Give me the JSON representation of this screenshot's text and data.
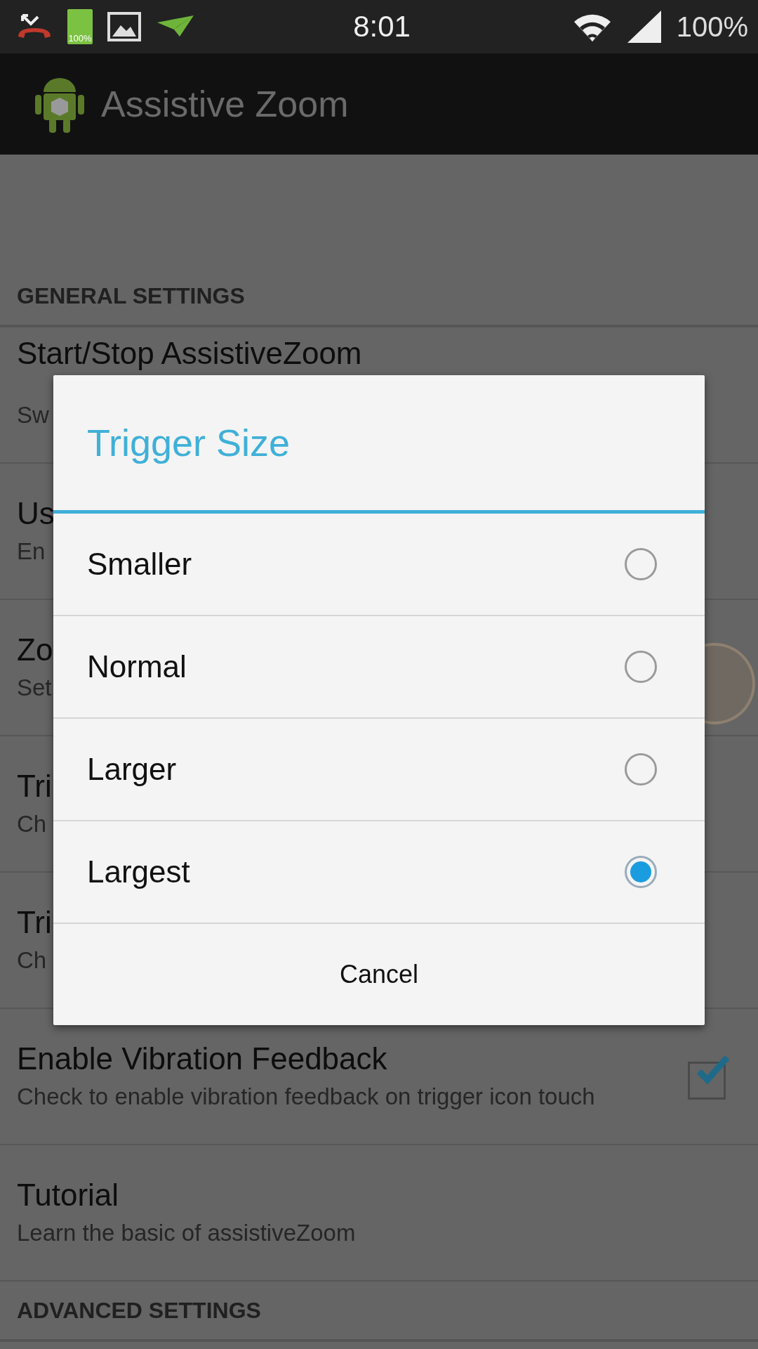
{
  "status_bar": {
    "battery_label": "100%",
    "time": "8:01",
    "battery_percent": "100%"
  },
  "action_bar": {
    "title": "Assistive Zoom"
  },
  "sections": [
    {
      "header": "GENERAL SETTINGS",
      "items": [
        {
          "title": "Start/Stop AssistiveZoom",
          "subtitle": "Sw"
        },
        {
          "title": "Us",
          "subtitle": "En"
        },
        {
          "title": "Zo",
          "subtitle": "Set"
        },
        {
          "title": "Tri",
          "subtitle": "Ch"
        },
        {
          "title": "Tri",
          "subtitle": "Ch"
        },
        {
          "title": "Enable Vibration Feedback",
          "subtitle": "Check to enable vibration feedback on trigger icon touch",
          "checked": true
        },
        {
          "title": "Tutorial",
          "subtitle": "Learn the basic of assistiveZoom"
        }
      ]
    },
    {
      "header": "ADVANCED SETTINGS"
    }
  ],
  "dialog": {
    "title": "Trigger Size",
    "options": [
      {
        "label": "Smaller",
        "selected": false
      },
      {
        "label": "Normal",
        "selected": false
      },
      {
        "label": "Larger",
        "selected": false
      },
      {
        "label": "Largest",
        "selected": true
      }
    ],
    "cancel": "Cancel"
  }
}
